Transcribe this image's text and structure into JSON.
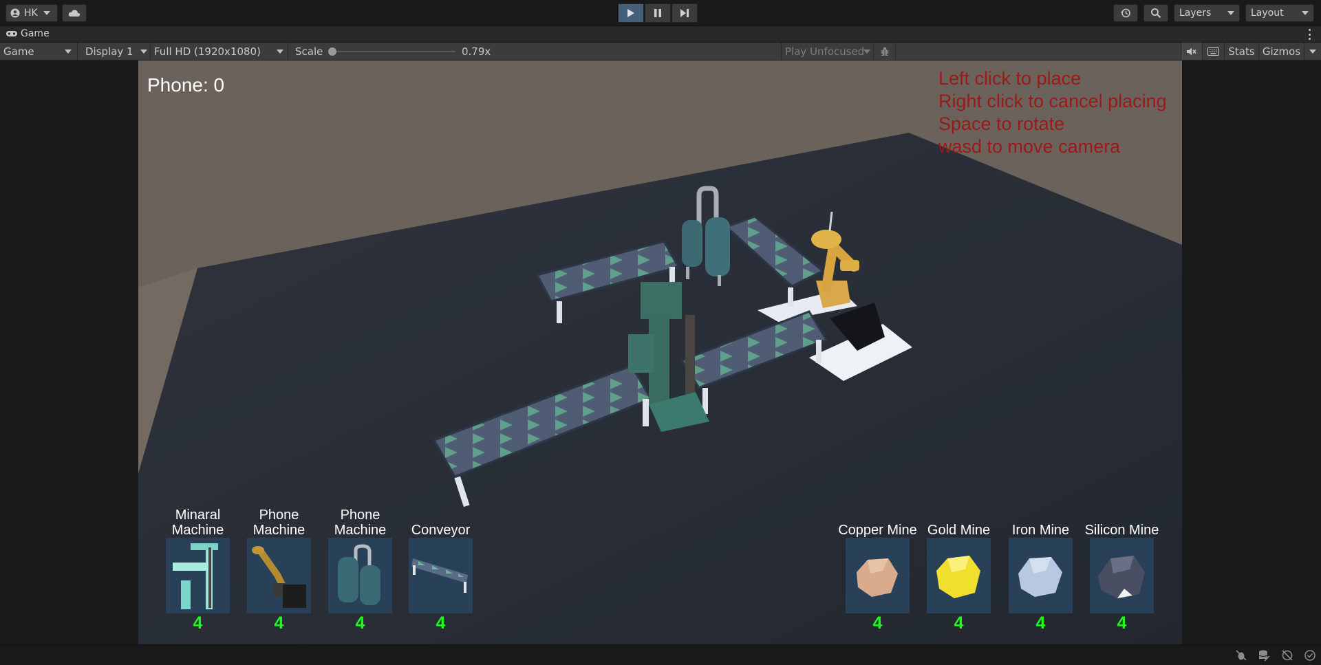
{
  "topbar": {
    "account_label": "HK",
    "layers_label": "Layers",
    "layout_label": "Layout"
  },
  "tab": {
    "title": "Game"
  },
  "toolbar": {
    "view_mode": "Game",
    "display": "Display 1",
    "resolution": "Full HD (1920x1080)",
    "scale_label": "Scale",
    "scale_value": "0.79x",
    "scale_level": 0.0,
    "play_mode": "Play Unfocused",
    "stats_label": "Stats",
    "gizmos_label": "Gizmos"
  },
  "game": {
    "phone_label": "Phone: 0",
    "instructions": [
      "Left click to place",
      "Right click to cancel placing",
      "Space to rotate",
      "wasd to move camera"
    ],
    "build_items": [
      {
        "label": "Minaral Machine",
        "count": "4",
        "icon": "mineral-machine-icon"
      },
      {
        "label": "Phone Machine",
        "count": "4",
        "icon": "robot-arm-icon"
      },
      {
        "label": "Phone Machine",
        "count": "4",
        "icon": "tank-machine-icon"
      },
      {
        "label": "Conveyor",
        "count": "4",
        "icon": "conveyor-icon"
      }
    ],
    "mine_items": [
      {
        "label": "Copper Mine",
        "count": "4",
        "color": "#d8ab8e"
      },
      {
        "label": "Gold Mine",
        "count": "4",
        "color": "#f2e22c"
      },
      {
        "label": "Iron Mine",
        "count": "4",
        "color": "#b6c7e0"
      },
      {
        "label": "Silicon Mine",
        "count": "4",
        "color": "#4b4f63"
      }
    ]
  },
  "colors": {
    "accent_play": "#46607c",
    "instruction_text": "#9a1a1a",
    "count_text": "#1bff1b",
    "card_bg": "#284159"
  }
}
